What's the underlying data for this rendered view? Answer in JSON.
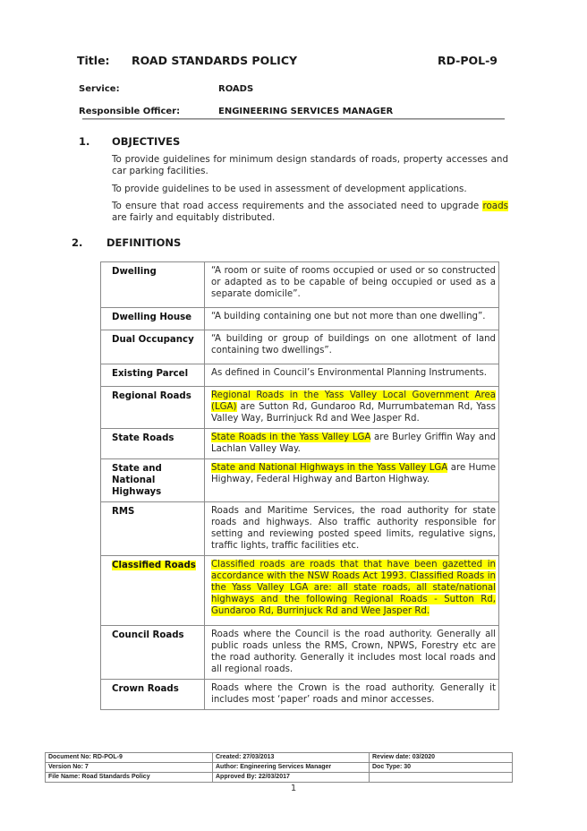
{
  "header": {
    "title_label": "Title:",
    "title": "ROAD STANDARDS POLICY",
    "doc_code": "RD-POL-9",
    "service_label": "Service:",
    "service_value": "ROADS",
    "officer_label": "Responsible Officer:",
    "officer_value": "ENGINEERING SERVICES MANAGER"
  },
  "sections": [
    {
      "number": "1.",
      "title": "OBJECTIVES",
      "paragraphs": [
        "To provide guidelines for minimum design standards of roads, property accesses and car parking facilities.",
        "To provide guidelines to be used in assessment of development applications.",
        {
          "before": "To ensure that road access requirements and the associated need to upgrade ",
          "highlight": "roads",
          "after": " are fairly and equitably distributed."
        }
      ]
    },
    {
      "number": "2.",
      "title": "DEFINITIONS"
    }
  ],
  "definitions": [
    {
      "term": "Dwelling",
      "highlight_term": false,
      "def_highlight": "",
      "def_text": "“A room or suite of rooms occupied or used or so constructed or adapted as to be capable of being occupied or used as a separate domicile”."
    },
    {
      "term": "Dwelling House",
      "highlight_term": false,
      "def_highlight": "",
      "def_text": "“A building containing one but not more than one dwelling”."
    },
    {
      "term": "Dual Occupancy",
      "highlight_term": false,
      "def_highlight": "",
      "def_text": "“A building or group of buildings on one allotment of land containing two dwellings”."
    },
    {
      "term": "Existing Parcel",
      "highlight_term": false,
      "def_highlight": "",
      "def_text": "As defined in Council’s Environmental Planning Instruments."
    },
    {
      "term": "Regional Roads",
      "highlight_term": false,
      "def_highlight": "Regional Roads in the Yass Valley Local Government Area (LGA)",
      "def_text": " are Sutton Rd, Gundaroo Rd, Murrumbateman Rd, Yass Valley Way, Burrinjuck Rd and Wee Jasper Rd."
    },
    {
      "term": "State Roads",
      "highlight_term": false,
      "def_highlight": "State Roads in the Yass Valley LGA",
      "def_text": " are Burley Griffin Way and Lachlan Valley Way."
    },
    {
      "term": "State and National Highways",
      "highlight_term": false,
      "def_highlight": "State and National Highways in the Yass Valley LGA",
      "def_text": " are Hume Highway, Federal Highway and Barton Highway."
    },
    {
      "term": "RMS",
      "highlight_term": false,
      "def_highlight": "",
      "def_text": "Roads and Maritime Services, the road authority for state roads and highways. Also traffic authority responsible for setting and reviewing posted speed limits, regulative signs, traffic  lights, traffic facilities etc."
    },
    {
      "term": "Classified Roads",
      "highlight_term": true,
      "def_highlight": "Classified roads are roads that that have been gazetted in accordance with the NSW Roads Act 1993. Classified Roads in the Yass Valley LGA are: all state roads, all state/national highways and the following Regional Roads -  Sutton Rd, Gundaroo Rd, Burrinjuck Rd and Wee Jasper Rd.",
      "def_text": ""
    },
    {
      "term": "Council Roads",
      "highlight_term": false,
      "def_highlight": "",
      "def_text": "Roads  where the Council  is  the  road authority.  Generally  all public roads unless the RMS, Crown, NPWS, Forestry etc are the road authority. Generally it includes most local roads and all regional roads."
    },
    {
      "term": "Crown Roads",
      "highlight_term": false,
      "def_highlight": "",
      "def_text": "Roads where the Crown is the road authority.  Generally it includes most ‘paper’ roads and minor accesses."
    }
  ],
  "footer": {
    "rows": [
      [
        "Document No: RD-POL-9",
        "Created: 27/03/2013",
        "Review date: 03/2020"
      ],
      [
        "Version No: 7",
        "Author: Engineering Services Manager",
        "Doc Type: 30"
      ],
      [
        "File Name: Road Standards Policy",
        "Approved By: 22/03/2017",
        ""
      ]
    ],
    "page_number": "1"
  },
  "colors": {
    "highlight": "#ffff00",
    "border": "#8a8a8a"
  }
}
